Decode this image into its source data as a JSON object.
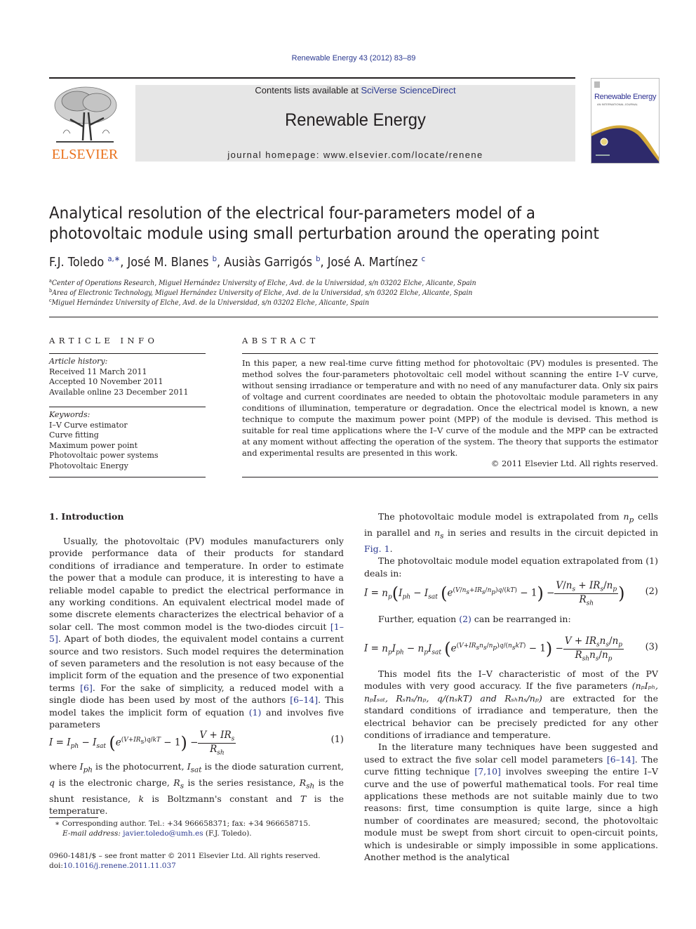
{
  "header": {
    "journal_ref": "Renewable Energy 43 (2012) 83–89",
    "contents_prefix": "Contents lists available at ",
    "contents_link": "SciVerse ScienceDirect",
    "journal_title": "Renewable Energy",
    "homepage_label": "journal homepage: ",
    "homepage_url": "www.elsevier.com/locate/renene",
    "publisher_logo_text": "ELSEVIER",
    "cover_title": "Renewable Energy",
    "cover_subtitle": "AN INTERNATIONAL JOURNAL",
    "colors": {
      "link": "#2b3990",
      "elsevier_orange": "#e9711c",
      "banner_bg": "#e6e6e6",
      "cover_navy": "#2e2a6b",
      "cover_gold": "#d4a93a"
    }
  },
  "article": {
    "title": "Analytical resolution of the electrical four-parameters model of a photovoltaic module using small perturbation around the operating point",
    "authors": [
      {
        "name": "F.J. Toledo",
        "sup": "a,∗",
        "sep": ", "
      },
      {
        "name": "José M. Blanes",
        "sup": "b",
        "sep": ", "
      },
      {
        "name": "Ausiàs Garrigós",
        "sup": "b",
        "sep": ", "
      },
      {
        "name": "José A. Martínez",
        "sup": "c",
        "sep": ""
      }
    ],
    "affiliations": [
      {
        "key": "a",
        "text": "Center of Operations Research, Miguel Hernández University of Elche, Avd. de la Universidad, s/n 03202 Elche, Alicante, Spain"
      },
      {
        "key": "b",
        "text": "Area of Electronic Technology, Miguel Hernández University of Elche, Avd. de la Universidad, s/n 03202 Elche, Alicante, Spain"
      },
      {
        "key": "c",
        "text": "Miguel Hernández University of Elche, Avd. de la Universidad, s/n 03202 Elche, Alicante, Spain"
      }
    ]
  },
  "article_info": {
    "heading": "ARTICLE INFO",
    "history_label": "Article history:",
    "history": [
      "Received 11 March 2011",
      "Accepted 10 November 2011",
      "Available online 23 December 2011"
    ],
    "keywords_label": "Keywords:",
    "keywords": [
      "I–V Curve estimator",
      "Curve fitting",
      "Maximum power point",
      "Photovoltaic power systems",
      "Photovoltaic Energy"
    ]
  },
  "abstract": {
    "heading": "ABSTRACT",
    "text": "In this paper, a new real-time curve fitting method for photovoltaic (PV) modules is presented. The method solves the four-parameters photovoltaic cell model without scanning the entire I–V curve, without sensing irradiance or temperature and with no need of any manufacturer data. Only six pairs of voltage and current coordinates are needed to obtain the photovoltaic module parameters in any conditions of illumination, temperature or degradation. Once the electrical model is known, a new technique to compute the maximum power point (MPP) of the module is devised. This method is suitable for real time applications where the I–V curve of the module and the MPP can be extracted at any moment without affecting the operation of the system. The theory that supports the estimator and experimental results are presented in this work.",
    "copyright": "© 2011 Elsevier Ltd. All rights reserved."
  },
  "intro": {
    "heading": "1.  Introduction",
    "p1_a": "Usually, the photovoltaic (PV) modules manufacturers only provide performance data of their products for standard conditions of irradiance and temperature. In order to estimate the power that a module can produce, it is interesting to have a reliable model capable to predict the electrical performance in any working conditions. An equivalent electrical model made of some discrete elements characterizes the electrical behavior of a solar cell. The most common model is the two-diodes circuit ",
    "ref_1_5": "[1–5]",
    "p1_b": ". Apart of both diodes, the equivalent model contains a current source and two resistors. Such model requires the determination of seven parameters and the resolution is not easy because of the implicit form of the equation and the presence of two exponential terms ",
    "ref_6": "[6]",
    "p1_c": ". For the sake of simplicity, a reduced model with a single diode has been used by most of the authors ",
    "ref_6_14": "[6–14]",
    "p1_d": ". This model takes the implicit form of equation ",
    "ref_eq1": "(1)",
    "p1_e": " and involves five parameters",
    "eq1_number": "(1)",
    "where_text": "is the photocurrent,",
    "p2": {
      "w1": "where ",
      "w2": " is the photocurrent, ",
      "w3": " is the diode saturation current, ",
      "w4": " is the electronic charge, ",
      "w5": " is the series resistance, ",
      "w6": " is the shunt resistance, ",
      "w7": " is Boltzmann's constant and ",
      "w8": " is the temperature."
    }
  },
  "right_col": {
    "p1_a": "The photovoltaic module model is extrapolated from ",
    "p1_b": " cells in parallel and ",
    "p1_c": " in series and results in the circuit depicted in ",
    "fig_ref": "Fig. 1",
    "p1_d": ".",
    "p2": "The photovoltaic module model equation extrapolated from (1) deals in:",
    "eq2_number": "(2)",
    "p3_a": "Further, equation ",
    "ref_eq2": "(2)",
    "p3_b": " can be rearranged in:",
    "eq3_number": "(3)",
    "p4_a": "This model fits the I–V characteristic of most of the PV modules with very good accuracy. If the five parameters ",
    "p4_params": "(nₚIₚₕ, nₚIₛₐₜ, Rₛnₛ/nₚ, q/(nₛkT) and Rₛₕnₛ/nₚ)",
    "p4_b": " are extracted for the standard conditions of irradiance and temperature, then the electrical behavior can be precisely predicted for any other conditions of irradiance and temperature.",
    "p5_a": "In the literature many techniques have been suggested and used to extract the five solar cell model parameters ",
    "ref_6_14": "[6–14]",
    "p5_b": ". The curve fitting technique ",
    "ref_7_10": "[7,10]",
    "p5_c": " involves sweeping the entire I–V curve and the use of powerful mathematical tools. For real time applications these methods are not suitable mainly due to two reasons: first, time consumption is quite large, since a high number of coordinates are measured; second, the photovoltaic module must be swept from short circuit to open-circuit points, which is undesirable or simply impossible in some applications. Another method is the analytical"
  },
  "footnotes": {
    "corresponding": "∗  Corresponding author. Tel.: +34 966658371; fax: +34 966658715.",
    "email_label": "E-mail address: ",
    "email": "javier.toledo@umh.es",
    "email_suffix": " (F.J. Toledo).",
    "front_matter": "0960-1481/$ – see front matter © 2011 Elsevier Ltd. All rights reserved.",
    "doi_label": "doi:",
    "doi": "10.1016/j.renene.2011.11.037"
  }
}
